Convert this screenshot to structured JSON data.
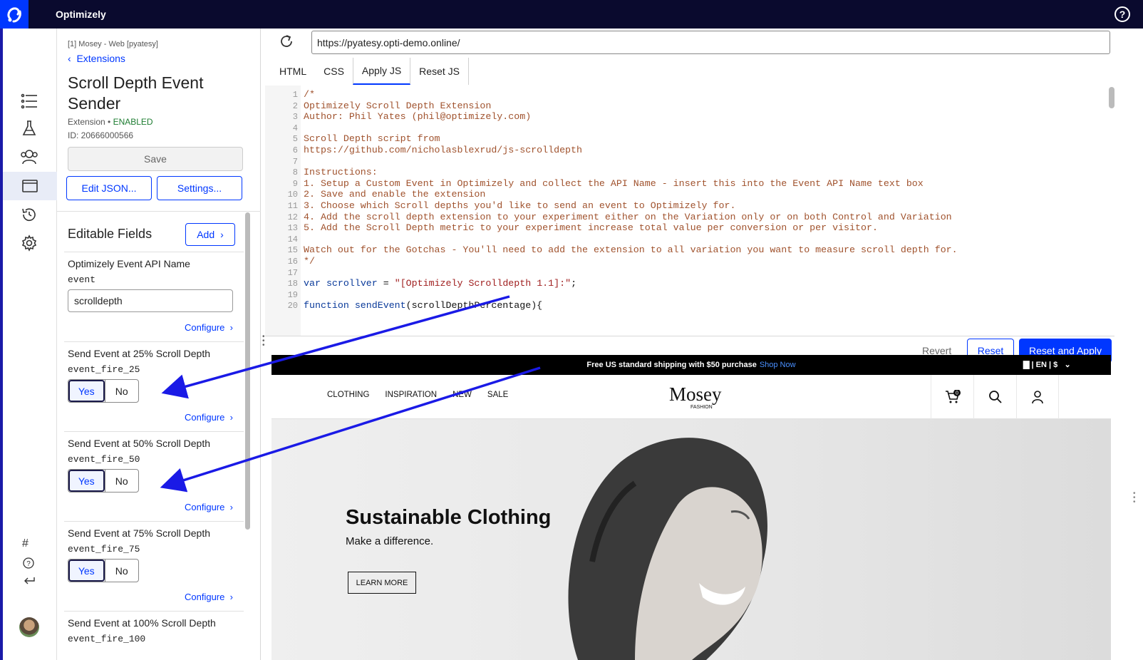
{
  "app": {
    "name": "Optimizely",
    "help_icon": "?"
  },
  "nav": {
    "items": [
      "list-icon",
      "flask-icon",
      "audience-icon",
      "extensions-icon",
      "history-icon",
      "gear-icon"
    ],
    "bottom": [
      "hash-icon",
      "help-circle-icon",
      "return-icon",
      "avatar"
    ]
  },
  "panel": {
    "crumb": "[1] Mosey - Web [pyatesy]",
    "back_label": "Extensions",
    "title": "Scroll Depth Event Sender",
    "type_label": "Extension •",
    "status": "ENABLED",
    "id_label": "ID: 20666000566",
    "save": "Save",
    "edit_json": "Edit JSON...",
    "settings": "Settings...",
    "editable_fields": "Editable Fields",
    "add": "Add",
    "fields": [
      {
        "label": "Optimizely Event API Name",
        "key": "event",
        "value": "scrolldepth",
        "configure": "Configure"
      },
      {
        "label": "Send Event at 25% Scroll Depth",
        "key": "event_fire_25",
        "yes": "Yes",
        "no": "No",
        "configure": "Configure"
      },
      {
        "label": "Send Event at 50% Scroll Depth",
        "key": "event_fire_50",
        "yes": "Yes",
        "no": "No",
        "configure": "Configure"
      },
      {
        "label": "Send Event at 75% Scroll Depth",
        "key": "event_fire_75",
        "yes": "Yes",
        "no": "No",
        "configure": "Configure"
      },
      {
        "label": "Send Event at 100% Scroll Depth",
        "key": "event_fire_100"
      }
    ]
  },
  "editor": {
    "url": "https://pyatesy.opti-demo.online/",
    "tabs": [
      "HTML",
      "CSS",
      "Apply JS",
      "Reset JS"
    ],
    "active_tab": "Apply JS",
    "code_lines": [
      "/*",
      "Optimizely Scroll Depth Extension",
      "Author: Phil Yates (phil@optimizely.com)",
      "",
      "Scroll Depth script from",
      "https://github.com/nicholasblexrud/js-scrolldepth",
      "",
      "Instructions:",
      "1. Setup a Custom Event in Optimizely and collect the API Name - insert this into the Event API Name text box",
      "2. Save and enable the extension",
      "3. Choose which Scroll depths you'd like to send an event to Optimizely for.",
      "4. Add the scroll depth extension to your experiment either on the Variation only or on both Control and Variation",
      "5. Add the Scroll Depth metric to your experiment increase total value per conversion or per visitor.",
      "",
      "Watch out for the Gotchas - You'll need to add the extension to all variation you want to measure scroll depth for.",
      "*/",
      "",
      "var scrollver = \"[Optimizely Scrolldepth 1.1]:\";",
      "",
      "function sendEvent(scrollDepthPercentage){"
    ],
    "revert": "Revert",
    "reset": "Reset",
    "reset_apply": "Reset and Apply"
  },
  "site": {
    "promo_text": "Free US standard shipping with $50 purchase",
    "promo_link": "Shop Now",
    "locale": "| EN | $",
    "nav_links": [
      "CLOTHING",
      "INSPIRATION",
      "NEW",
      "SALE"
    ],
    "logo": "Mosey",
    "logo_sub": "FASHION",
    "cart_count": "0",
    "hero_title": "Sustainable Clothing",
    "hero_sub": "Make a difference.",
    "cta": "LEARN MORE"
  }
}
